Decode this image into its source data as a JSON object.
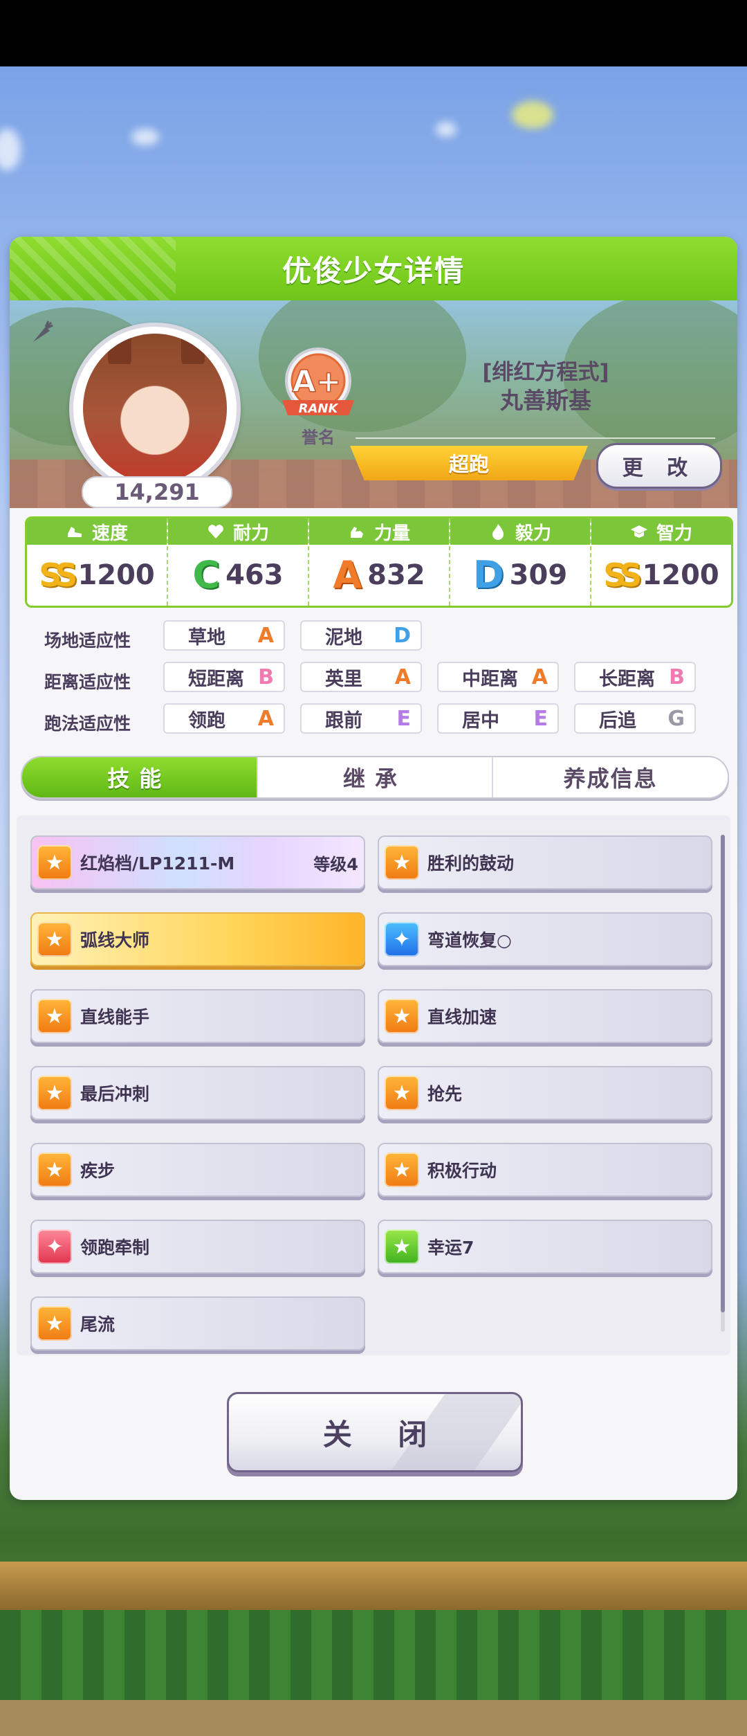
{
  "panel": {
    "title": "优俊少女详情"
  },
  "character": {
    "fans": "14,291",
    "rank_badge_text": "A+",
    "rank_badge_sub": "RANK",
    "rank_caption": "誉名",
    "epithet": "[绯红方程式]",
    "name": "丸善斯基",
    "running_style": "超跑",
    "change_label": "更 改"
  },
  "stats": [
    {
      "label": "速度",
      "icon": "shoe-icon",
      "grade": "SS",
      "value": "1200"
    },
    {
      "label": "耐力",
      "icon": "heart-icon",
      "grade": "C",
      "value": "463"
    },
    {
      "label": "力量",
      "icon": "muscle-icon",
      "grade": "A",
      "value": "832"
    },
    {
      "label": "毅力",
      "icon": "flame-icon",
      "grade": "D",
      "value": "309"
    },
    {
      "label": "智力",
      "icon": "graduation-cap-icon",
      "grade": "SS",
      "value": "1200"
    }
  ],
  "aptitudes": {
    "track": {
      "label": "场地适应性",
      "items": [
        {
          "name": "草地",
          "grade": "A"
        },
        {
          "name": "泥地",
          "grade": "D"
        }
      ]
    },
    "distance": {
      "label": "距离适应性",
      "items": [
        {
          "name": "短距离",
          "grade": "B"
        },
        {
          "name": "英里",
          "grade": "A"
        },
        {
          "name": "中距离",
          "grade": "A"
        },
        {
          "name": "长距离",
          "grade": "B"
        }
      ]
    },
    "strategy": {
      "label": "跑法适应性",
      "items": [
        {
          "name": "领跑",
          "grade": "A"
        },
        {
          "name": "跟前",
          "grade": "E"
        },
        {
          "name": "居中",
          "grade": "E"
        },
        {
          "name": "后追",
          "grade": "G"
        }
      ]
    }
  },
  "tabs": [
    {
      "label": "技能"
    },
    {
      "label": "继承"
    },
    {
      "label": "养成信息"
    }
  ],
  "skills": [
    {
      "name": "红焰档/LP1211-M",
      "level": "等级4",
      "icon": "runner-icon"
    },
    {
      "name": "胜利的鼓动",
      "icon": "runner-icon"
    },
    {
      "name": "弧线大师",
      "icon": "runner-icon"
    },
    {
      "name": "弯道恢复○",
      "icon": "sparkle-icon"
    },
    {
      "name": "直线能手",
      "icon": "runner-icon"
    },
    {
      "name": "直线加速",
      "icon": "runner-icon"
    },
    {
      "name": "最后冲刺",
      "icon": "runner-icon"
    },
    {
      "name": "抢先",
      "icon": "runner-icon"
    },
    {
      "name": "疾步",
      "icon": "runner-icon"
    },
    {
      "name": "积极行动",
      "icon": "runner-icon"
    },
    {
      "name": "领跑牵制",
      "icon": "sparkle-red-icon"
    },
    {
      "name": "幸运7",
      "icon": "runner-green-icon"
    },
    {
      "name": "尾流",
      "icon": "runner-icon"
    }
  ],
  "close_label": "关 闭",
  "colors": {
    "accent_green": "#6fc61a",
    "ribbon_gold": "#f1a616",
    "text_purple": "#4a3e5c"
  }
}
